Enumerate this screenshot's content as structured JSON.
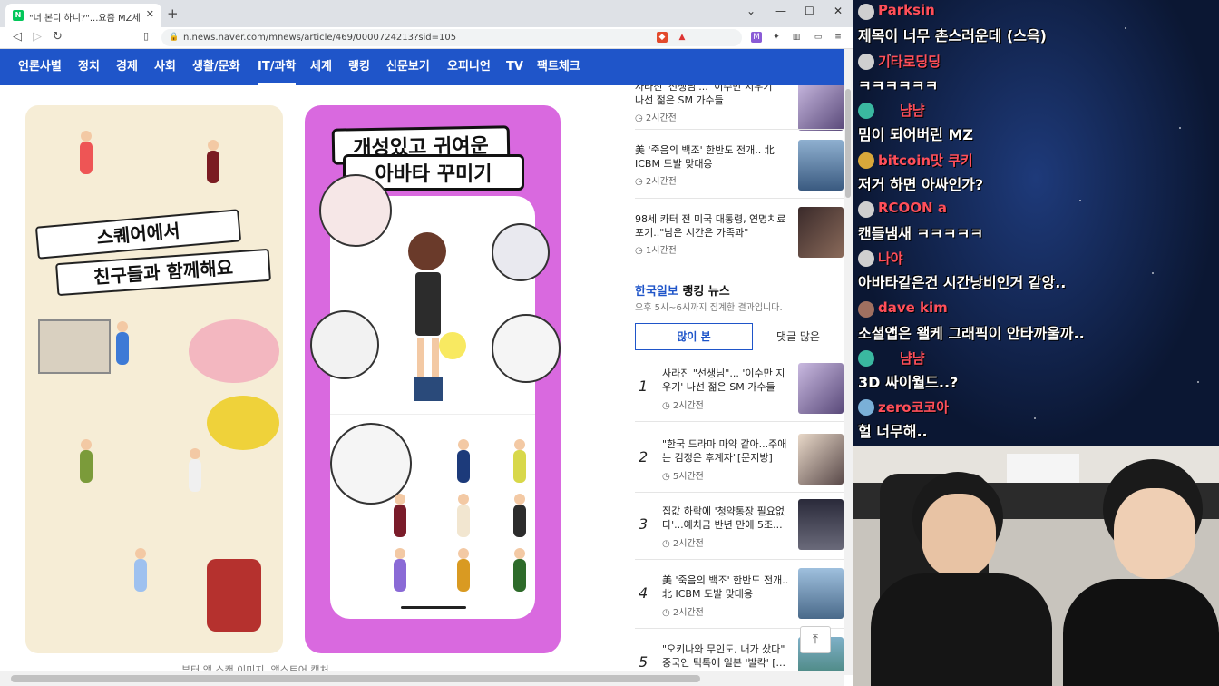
{
  "browser": {
    "tab_title": "\"너 본디 하니?\"...요즘 MZ세대서",
    "tab_close": "✕",
    "new_tab": "+",
    "url": "n.news.naver.com/mnews/article/469/0000724213?sid=105"
  },
  "nav": {
    "items": [
      "언론사별",
      "정치",
      "경제",
      "사회",
      "생활/문화",
      "IT/과학",
      "세계",
      "랭킹",
      "신문보기",
      "오피니언",
      "TV",
      "팩트체크"
    ],
    "active": "IT/과학"
  },
  "article": {
    "image1_banner_1": "스퀘어에서",
    "image1_banner_2": "친구들과 함께해요",
    "image2_title_1": "개성있고 귀여운",
    "image2_title_2": "아바타 꾸미기",
    "caption": "부터 앱 스캔 이미지, 앱스토어 캡처"
  },
  "sidebar": {
    "news": [
      {
        "title": "사라진 '선생님'... '이수만 지우기' 나선 젊은 SM 가수들",
        "time": "2시간전"
      },
      {
        "title": "美 '죽음의 백조' 한반도 전개.. 北 ICBM 도발 맞대응",
        "time": "2시간전"
      },
      {
        "title": "98세 카터 전 미국 대통령, 연명치료 포기..\"남은 시간은 가족과\"",
        "time": "1시간전"
      }
    ],
    "ranking_brand": "한국일보",
    "ranking_title": "랭킹 뉴스",
    "ranking_sub": "오후 5시~6시까지 집계한 결과입니다.",
    "tab_most_viewed": "많이 본",
    "tab_most_commented": "댓글 많은",
    "ranking": [
      {
        "rank": "1",
        "title": "사라진 \"선생님\"... '이수만 지우기' 나선 젊은 SM 가수들",
        "time": "2시간전"
      },
      {
        "rank": "2",
        "title": "\"한국 드라마 마약 같아...주애는 김정은 후계자\"[문지방]",
        "time": "5시간전"
      },
      {
        "rank": "3",
        "title": "집값 하락에 '청약통장 필요없다'...예치금 반년 만에 5조...",
        "time": "2시간전"
      },
      {
        "rank": "4",
        "title": "美 '죽음의 백조' 한반도 전개.. 北 ICBM 도발 맞대응",
        "time": "2시간전"
      },
      {
        "rank": "5",
        "title": "\"오키나와 무인도, 내가 샀다\" 중국인 틱톡에 일본 '발칵' [...",
        "time": ""
      }
    ]
  },
  "chat": [
    {
      "name": "Parksin",
      "message": "제목이 너무 촌스러운데 (스윽)"
    },
    {
      "name": "기타로딩딩",
      "message": "ㅋㅋㅋㅋㅋㅋ"
    },
    {
      "name": "냠냠",
      "message": "밈이 되어버린 MZ"
    },
    {
      "name": "bitcoin맛 쿠키",
      "message": "저거 하면 아싸인가?"
    },
    {
      "name": "RCOON a",
      "message": "캔들냄새 ㅋㅋㅋㅋㅋ"
    },
    {
      "name": "나야",
      "message": "아바타같은건 시간낭비인거 같앙.."
    },
    {
      "name": "dave kim",
      "message": "소셜앱은 왤케 그래픽이 안타까울까.."
    },
    {
      "name": "냠냠",
      "message": "3D 싸이월드..?"
    },
    {
      "name": "zero코코아",
      "message": "헐 너무해.."
    }
  ],
  "colors": {
    "nav_bg": "#1f55c9",
    "chat_name": "#ff4f5a",
    "accent": "#1f55c9"
  }
}
